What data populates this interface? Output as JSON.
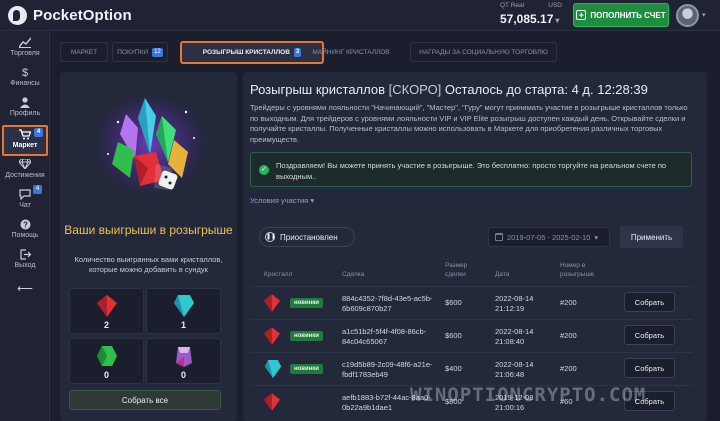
{
  "header": {
    "logo_text": "PocketOption",
    "account_type": "QT Real",
    "currency": "USD",
    "balance": "57,085.17",
    "deposit_label": "ПОПОЛНИТЬ СЧЕТ"
  },
  "sidebar": {
    "items": [
      {
        "label": "Торговля",
        "icon": "chart-icon"
      },
      {
        "label": "Финансы",
        "icon": "dollar-icon"
      },
      {
        "label": "Профиль",
        "icon": "user-icon"
      },
      {
        "label": "Маркет",
        "icon": "cart-icon",
        "badge": "4"
      },
      {
        "label": "Достижения",
        "icon": "diamond-icon"
      },
      {
        "label": "Чат",
        "icon": "chat-icon",
        "badge": "4"
      },
      {
        "label": "Помощь",
        "icon": "help-icon"
      },
      {
        "label": "Выход",
        "icon": "logout-icon"
      }
    ]
  },
  "tabs": [
    {
      "label": "МАРКЕТ"
    },
    {
      "label": "ПОКУПКИ",
      "badge": "12"
    },
    {
      "label": "РОЗЫГРЫШ КРИСТАЛЛОВ",
      "badge": "3"
    },
    {
      "label": "МАЙНИНГ КРИСТАЛЛОВ"
    },
    {
      "label": "НАГРАДЫ ЗА СОЦИАЛЬНУЮ ТОРГОВЛЮ"
    }
  ],
  "left_panel": {
    "title": "Ваши выигрыши в розыгрыше",
    "subtitle": "Количество выигранных вами кристаллов, которые можно добавить в сундук",
    "crystals": [
      {
        "color": "#e0303a",
        "count": "2"
      },
      {
        "color": "#2fc7d0",
        "count": "1"
      },
      {
        "color": "#2fbf4a",
        "count": "0"
      },
      {
        "color": "#9a5cc9",
        "count": "0"
      }
    ],
    "collect_all_label": "Собрать все"
  },
  "right_panel": {
    "title": "Розыгрыш кристаллов",
    "status": "[СКОРО]",
    "countdown": "Осталось до старта: 4 д. 12:28:39",
    "description": "Трейдеры с уровнями лояльности \"Начинающий\", \"Мастер\", \"Гуру\" могут принимать участие в розыгрыше кристаллов только по выходным. Для трейдеров с уровнями лояльности VIP и VIP Elite розыгрыш доступен каждый день. Открывайте сделки и получайте кристаллы. Полученные кристаллы можно использовать в Маркете для приобретения различных торговых преимуществ.",
    "notice": "Поздравляем! Вы можете принять участие в розыгрыше. Это бесплатно: просто торгуйте на реальном счете по выходным..",
    "conditions_label": "Условия участия",
    "paused_label": "Приостановлен",
    "date_range": "2019-07-05 - 2025-02-10",
    "apply_label": "Применить",
    "columns": {
      "crystal": "Кристалл",
      "deal": "Сделка",
      "size": "Размер сделки",
      "date": "Дата",
      "number": "Номер в розыгрыше"
    },
    "rows": [
      {
        "crystal": "#e0303a",
        "badge": "новинки",
        "deal": "884c4352-7f8d-43e5-ac5b-6b609c870b27",
        "amount": "$600",
        "date": "2022-08-14 21:12:19",
        "number": "#200",
        "action": "Собрать"
      },
      {
        "crystal": "#e0303a",
        "badge": "новинки",
        "deal": "a1c51b2f-5f4f-4f08-86cb-84c04c65067",
        "amount": "$600",
        "date": "2022-08-14 21:08:40",
        "number": "#200",
        "action": "Собрать"
      },
      {
        "crystal": "#2fc7d0",
        "badge": "новинки",
        "deal": "c19d5b89-2c09-48f6-a21e-fbdf1783eb49",
        "amount": "$400",
        "date": "2022-08-14 21:06:48",
        "number": "#200",
        "action": "Собрать"
      },
      {
        "crystal": "#e0303a",
        "badge": "",
        "deal": "aefb1883-b72f-44ac-8aa0-0b22a9b1dae1",
        "amount": "$800",
        "date": "2019-12-08 21:00:16",
        "number": "#60",
        "action": "Собрать"
      }
    ]
  },
  "watermark": "WINOPTIONCRYPTO.COM"
}
